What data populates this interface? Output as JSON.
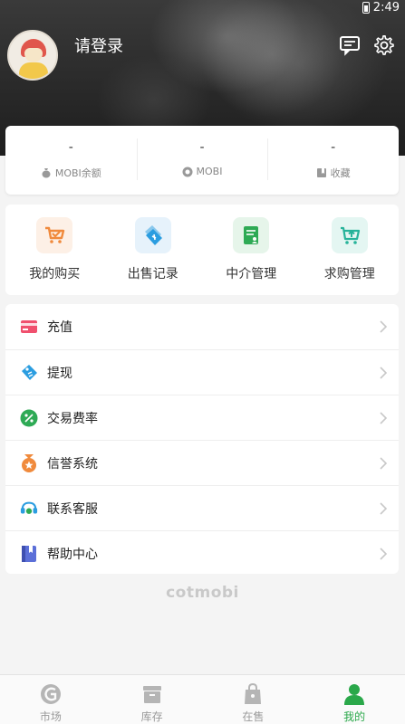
{
  "status_bar": {
    "time": "2:49"
  },
  "header": {
    "login_label": "请登录",
    "icons": [
      "avatar-icon",
      "message-icon",
      "gear-icon"
    ]
  },
  "stats": [
    {
      "value": "-",
      "label": "MOBI余额",
      "icon": "money-bag-icon"
    },
    {
      "value": "-",
      "label": "MOBI",
      "icon": "coin-icon"
    },
    {
      "value": "-",
      "label": "收藏",
      "icon": "bookmark-icon"
    }
  ],
  "actions": [
    {
      "label": "我的购买",
      "icon": "cart-icon",
      "color": "#f08a3c"
    },
    {
      "label": "出售记录",
      "icon": "tags-icon",
      "color": "#2b9de0"
    },
    {
      "label": "中介管理",
      "icon": "document-user-icon",
      "color": "#2eaa55"
    },
    {
      "label": "求购管理",
      "icon": "cart-upload-icon",
      "color": "#27b39a"
    }
  ],
  "menu": [
    {
      "label": "充值",
      "icon": "card-icon",
      "color": "#f0506e"
    },
    {
      "label": "提现",
      "icon": "ticket-icon",
      "color": "#2b9de0"
    },
    {
      "label": "交易费率",
      "icon": "percent-icon",
      "color": "#2eaa55"
    },
    {
      "label": "信誉系统",
      "icon": "medal-icon",
      "color": "#f08a3c"
    },
    {
      "label": "联系客服",
      "icon": "headset-icon",
      "color": "#2b9de0"
    },
    {
      "label": "帮助中心",
      "icon": "book-icon",
      "color": "#5b6fd8"
    }
  ],
  "brand": "cotmobi",
  "nav": [
    {
      "label": "市场",
      "icon": "market-icon"
    },
    {
      "label": "库存",
      "icon": "inventory-icon"
    },
    {
      "label": "在售",
      "icon": "shopping-bag-icon"
    },
    {
      "label": "我的",
      "icon": "user-icon"
    }
  ],
  "colors": {
    "accent": "#2aa84a",
    "inactive": "#9a9a9a"
  }
}
